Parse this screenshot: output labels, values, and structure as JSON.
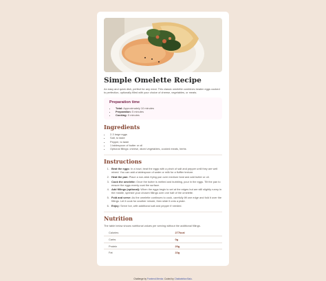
{
  "recipe": {
    "title": "Simple Omelette Recipe",
    "intro": "An easy and quick dish, perfect for any meal. This classic omelette combines beaten eggs cooked to perfection, optionally filled with your choice of cheese, vegetables, or meats."
  },
  "preparation": {
    "heading": "Preparation time",
    "items": [
      {
        "label": "Total:",
        "value": "Approximately 10 minutes"
      },
      {
        "label": "Preparation:",
        "value": "5 minutes"
      },
      {
        "label": "Cooking:",
        "value": "5 minutes"
      }
    ]
  },
  "ingredients": {
    "heading": "Ingredients",
    "items": [
      "2-3 large eggs",
      "Salt, to taste",
      "Pepper, to taste",
      "1 tablespoon of butter or oil",
      "Optional fillings: cheese, diced vegetables, cooked meats, herbs"
    ]
  },
  "instructions": {
    "heading": "Instructions",
    "steps": [
      {
        "label": "Beat the eggs:",
        "text": "In a bowl, beat the eggs with a pinch of salt and pepper until they are well mixed. You can add a tablespoon of water or milk for a fluffier texture."
      },
      {
        "label": "Heat the pan:",
        "text": "Place a non-stick frying pan over medium heat and add butter or oil."
      },
      {
        "label": "Cook the omelette:",
        "text": "Once the butter is melted and bubbling, pour in the eggs. Tilt the pan to ensure the eggs evenly coat the surface."
      },
      {
        "label": "Add fillings (optional):",
        "text": "When the eggs begin to set at the edges but are still slightly runny in the middle, sprinkle your chosen fillings over one half of the omelette."
      },
      {
        "label": "Fold and serve:",
        "text": "As the omelette continues to cook, carefully lift one edge and fold it over the fillings. Let it cook for another minute, then slide it onto a plate."
      },
      {
        "label": "Enjoy:",
        "text": "Serve hot, with additional salt and pepper if needed."
      }
    ]
  },
  "nutrition": {
    "heading": "Nutrition",
    "intro": "The table below shows nutritional values per serving without the additional fillings.",
    "rows": [
      {
        "name": "Calories",
        "value": "277kcal"
      },
      {
        "name": "Carbs",
        "value": "0g"
      },
      {
        "name": "Protein",
        "value": "20g"
      },
      {
        "name": "Fat",
        "value": "22g"
      }
    ]
  },
  "footer": {
    "prefix": "Challenge by",
    "challenge_link": "Frontend Mentor",
    "middle": ". Coded by",
    "author_link": "Chaitanbtian Balu",
    "suffix": "."
  },
  "colors": {
    "page_bg": "#f2e5da",
    "card_bg": "#ffffff",
    "heading_brown": "#854632",
    "prep_plum": "#7a284e",
    "prep_bg": "#fff7fb",
    "link_blue": "#3e52a3"
  }
}
